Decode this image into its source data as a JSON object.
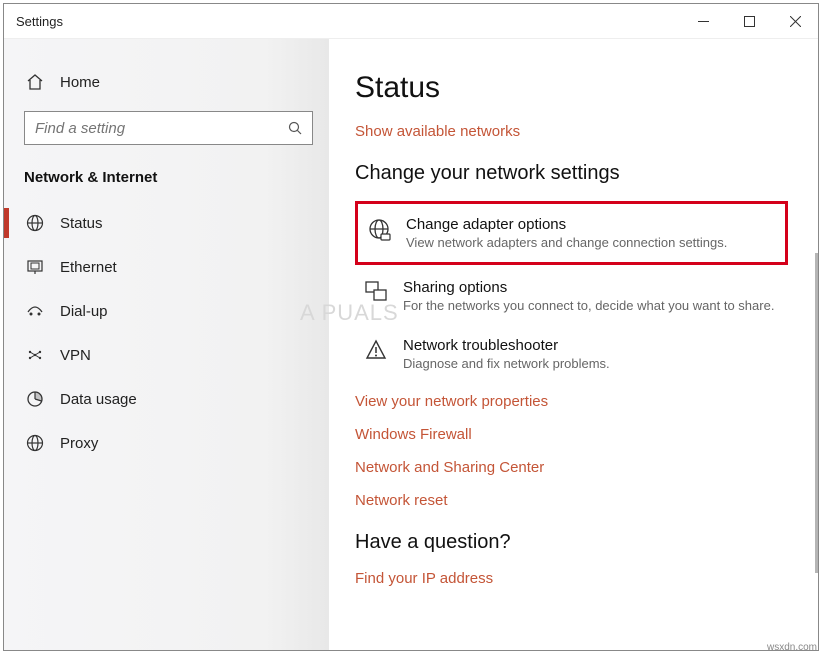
{
  "window": {
    "title": "Settings"
  },
  "sidebar": {
    "home": "Home",
    "search_placeholder": "Find a setting",
    "section": "Network & Internet",
    "items": [
      {
        "label": "Status"
      },
      {
        "label": "Ethernet"
      },
      {
        "label": "Dial-up"
      },
      {
        "label": "VPN"
      },
      {
        "label": "Data usage"
      },
      {
        "label": "Proxy"
      }
    ]
  },
  "panel": {
    "title": "Status",
    "top_link": "Show available networks",
    "section1_title": "Change your network settings",
    "options": [
      {
        "title": "Change adapter options",
        "desc": "View network adapters and change connection settings."
      },
      {
        "title": "Sharing options",
        "desc": "For the networks you connect to, decide what you want to share."
      },
      {
        "title": "Network troubleshooter",
        "desc": "Diagnose and fix network problems."
      }
    ],
    "links": [
      "View your network properties",
      "Windows Firewall",
      "Network and Sharing Center",
      "Network reset"
    ],
    "section2_title": "Have a question?",
    "q_link": "Find your IP address"
  },
  "watermark": "A  PUALS",
  "attrib": "wsxdn.com"
}
